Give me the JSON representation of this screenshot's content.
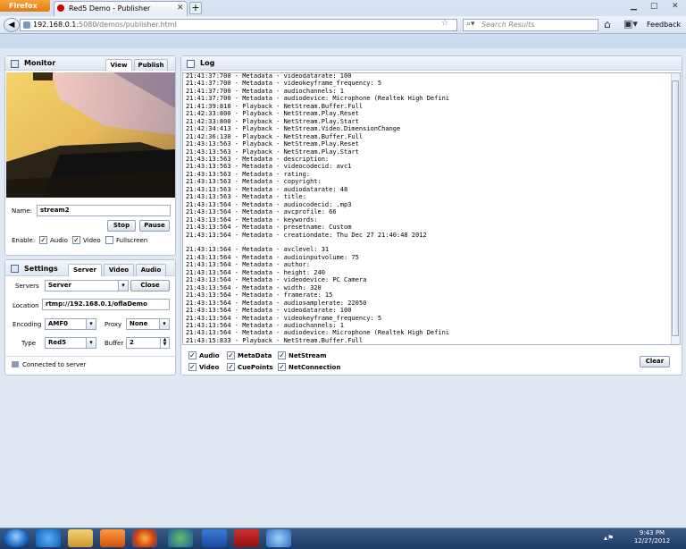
{
  "browser": {
    "menu_button": "Firefox",
    "tab_title": "Red5 Demo - Publisher",
    "new_tab": "+",
    "url_host": "192.168.0.1",
    "url_path": ":5080/demos/publisher.html",
    "search_placeholder": "Search Results",
    "feedback": "Feedback"
  },
  "monitor": {
    "title": "Monitor",
    "tabs": [
      "View",
      "Publish"
    ],
    "name_label": "Name:",
    "name_value": "stream2",
    "stop_button": "Stop",
    "pause_button": "Pause",
    "enable_label": "Enable:",
    "audio_label": "Audio",
    "video_label": "Video",
    "fullscreen_label": "Fullscreen"
  },
  "settings": {
    "title": "Settings",
    "tabs": [
      "Server",
      "Video",
      "Audio"
    ],
    "servers_label": "Servers",
    "servers_value": "Server",
    "close_button": "Close",
    "location_label": "Location",
    "location_value": "rtmp://192.168.0.1/oflaDemo",
    "encoding_label": "Encoding",
    "encoding_value": "AMF0",
    "proxy_label": "Proxy",
    "proxy_value": "None",
    "type_label": "Type",
    "type_value": "Red5",
    "buffer_label": "Buffer",
    "buffer_value": "2",
    "status": "Connected to server"
  },
  "log": {
    "title": "Log",
    "lines": [
      "21:41:37:700 - Metadata - videodatarate: 100",
      "21:41:37:700 - Metadata - videokeyframe_frequency: 5",
      "21:41:37:700 - Metadata - audiochannels: 1",
      "21:41:37:700 - Metadata - audiodevice: Microphone (Realtek High Defini",
      "21:41:39:818 - Playback - NetStream.Buffer.Full",
      "21:42:33:800 - Playback - NetStream.Play.Reset",
      "21:42:33:800 - Playback - NetStream.Play.Start",
      "21:42:34:413 - Playback - NetStream.Video.DimensionChange",
      "21:42:36:130 - Playback - NetStream.Buffer.Full",
      "21:43:13:563 - Playback - NetStream.Play.Reset",
      "21:43:13:563 - Playback - NetStream.Play.Start",
      "21:43:13:563 - Metadata - description:",
      "21:43:13:563 - Metadata - videocodecid: avc1",
      "21:43:13:563 - Metadata - rating:",
      "21:43:13:563 - Metadata - copyright:",
      "21:43:13:563 - Metadata - audiodatarate: 48",
      "21:43:13:563 - Metadata - title:",
      "21:43:13:564 - Metadata - audiocodecid: .mp3",
      "21:43:13:564 - Metadata - avcprofile: 66",
      "21:43:13:564 - Metadata - keywords:",
      "21:43:13:564 - Metadata - presetname: Custom",
      "21:43:13:564 - Metadata - creationdate: Thu Dec 27 21:40:48 2012",
      "",
      "21:43:13:564 - Metadata - avclevel: 31",
      "21:43:13:564 - Metadata - audioinputvolume: 75",
      "21:43:13:564 - Metadata - author:",
      "21:43:13:564 - Metadata - height: 240",
      "21:43:13:564 - Metadata - videodevice: PC Camera",
      "21:43:13:564 - Metadata - width: 320",
      "21:43:13:564 - Metadata - framerate: 15",
      "21:43:13:564 - Metadata - audiosamplerate: 22050",
      "21:43:13:564 - Metadata - videodatarate: 100",
      "21:43:13:564 - Metadata - videokeyframe_frequency: 5",
      "21:43:13:564 - Metadata - audiochannels: 1",
      "21:43:13:564 - Metadata - audiodevice: Microphone (Realtek High Defini",
      "21:43:15:833 - Playback - NetStream.Buffer.Full"
    ],
    "filters": [
      "Audio",
      "MetaData",
      "NetStream",
      "Video",
      "CuePoints",
      "NetConnection"
    ],
    "clear_button": "Clear"
  },
  "taskbar": {
    "time": "9:43 PM",
    "date": "12/27/2012"
  }
}
